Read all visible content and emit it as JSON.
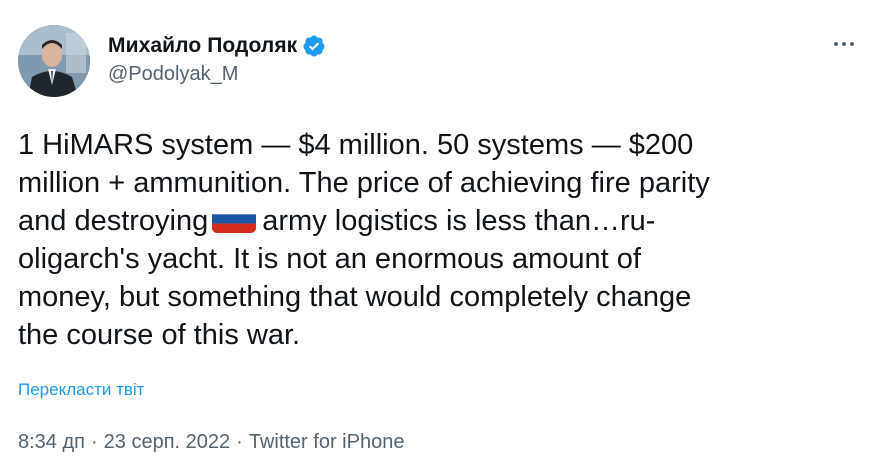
{
  "author": {
    "display_name": "Михайло Подоляк",
    "handle": "@Podolyak_M",
    "verified": true,
    "verified_color": "#1d9bf0"
  },
  "tweet": {
    "lines": [
      "1 HiMARS system — $4 million. 50 systems — $200",
      "million + ammunition. The price of achieving fire parity",
      "and destroying",
      "army logistics is less than…ru-",
      "oligarch's yacht. It is not an enormous amount of",
      "money, but something that would completely change",
      "the course of this war."
    ],
    "emoji": "russia-flag"
  },
  "translate_label": "Перекласти твіт",
  "meta": {
    "time": "8:34 дп",
    "separator": "·",
    "date": "23 серп. 2022",
    "source": "Twitter for iPhone"
  },
  "icons": {
    "more": "more-horizontal-icon",
    "verified": "verified-badge-icon"
  },
  "colors": {
    "text": "#0f1419",
    "secondary": "#536471",
    "link": "#1d9bf0"
  }
}
